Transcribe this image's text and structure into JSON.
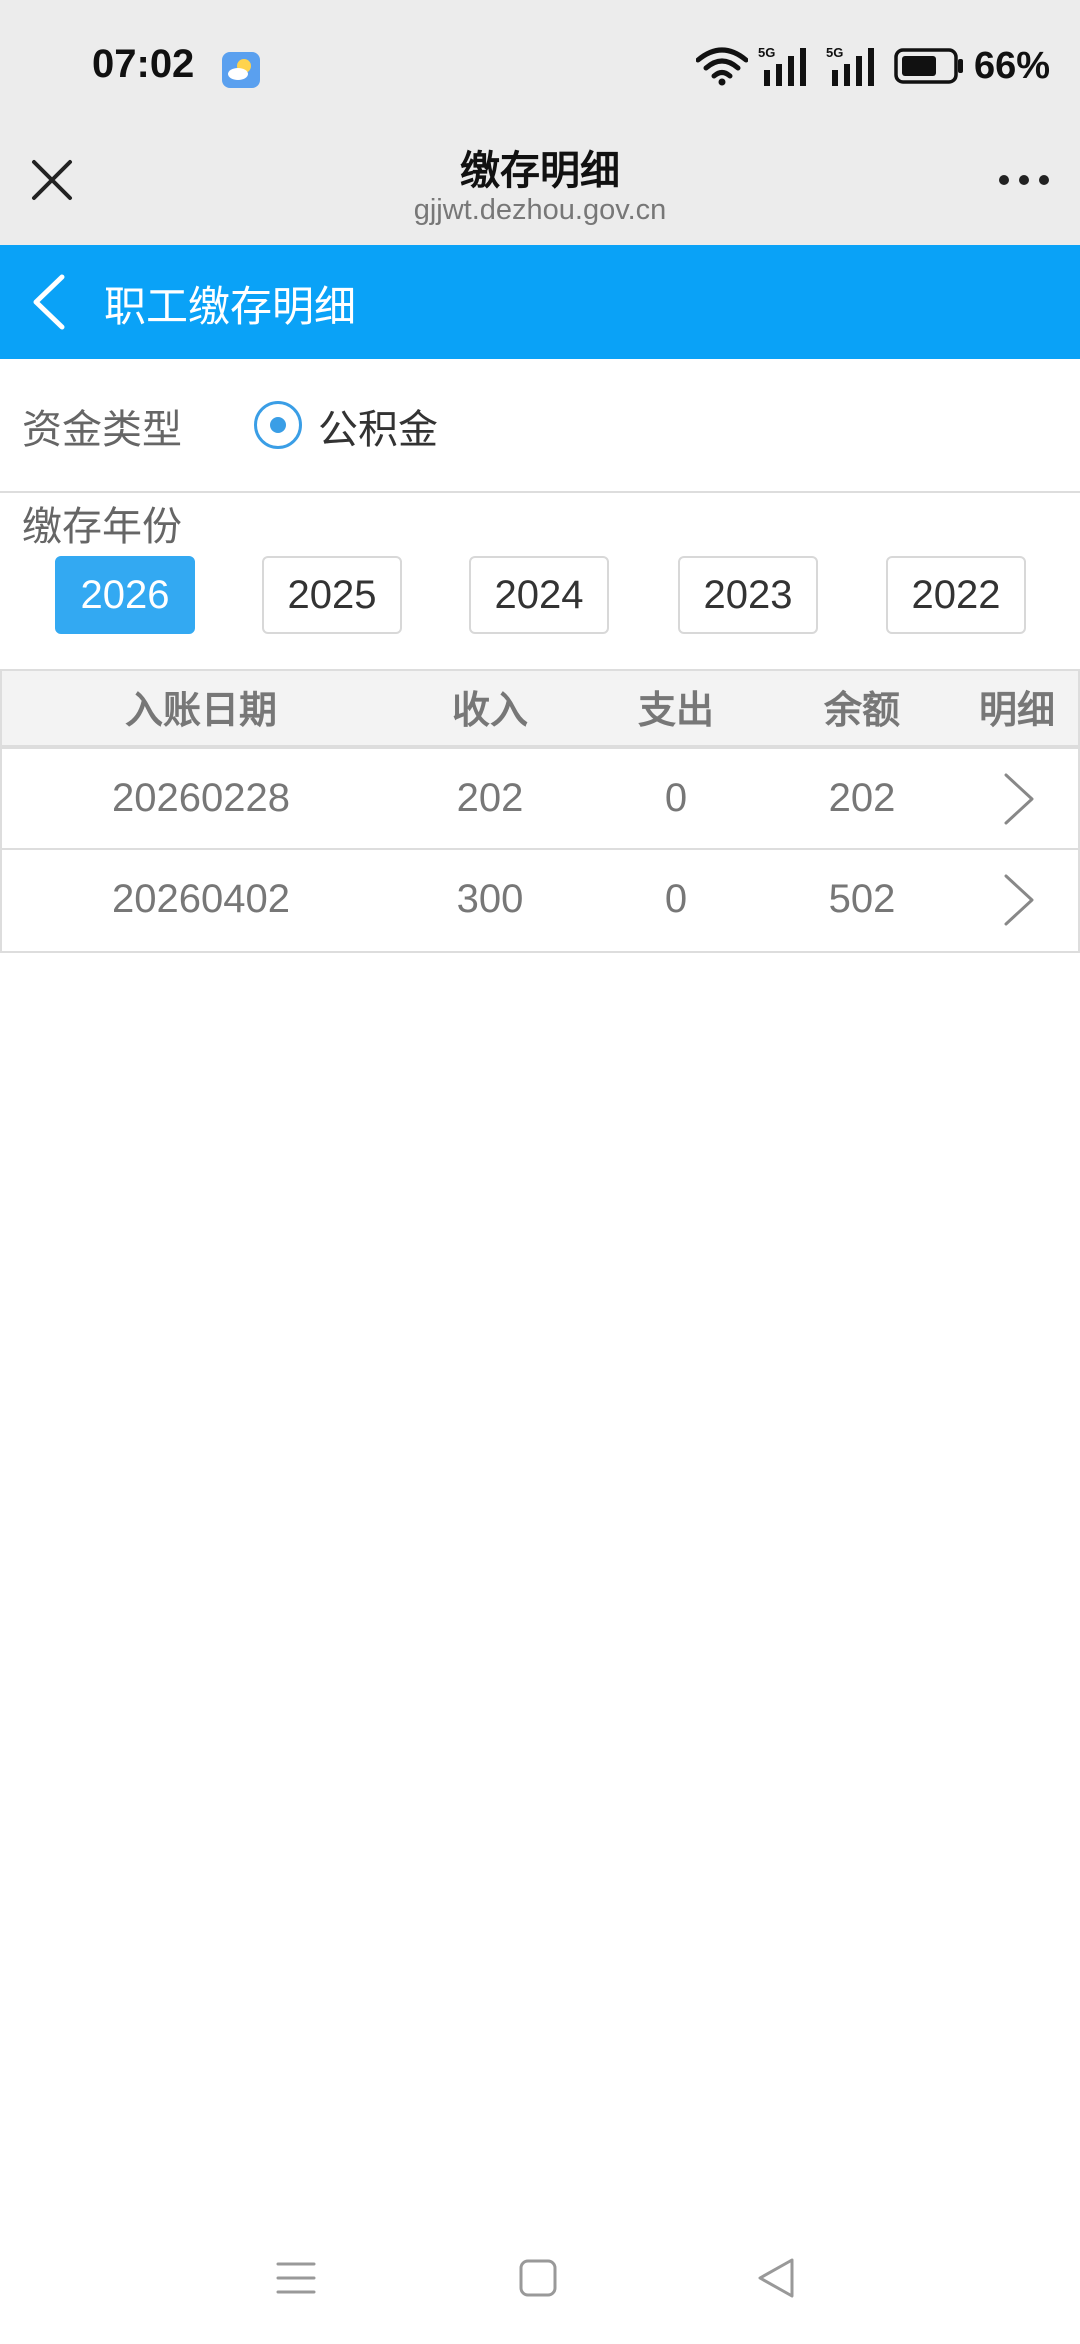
{
  "status_bar": {
    "time": "07:02",
    "battery": "66%",
    "network": [
      "5G",
      "5G"
    ],
    "icons": [
      "wifi-icon",
      "signal-icon",
      "battery-icon"
    ]
  },
  "browser": {
    "title": "缴存明细",
    "url": "gjjwt.dezhou.gov.cn"
  },
  "header": {
    "title": "职工缴存明细"
  },
  "fund_type": {
    "label": "资金类型",
    "option": "公积金",
    "selected": true
  },
  "years": {
    "label": "缴存年份",
    "options": [
      "2026",
      "2025",
      "2024",
      "2023",
      "2022"
    ],
    "selected": "2026"
  },
  "table": {
    "headers": [
      "入账日期",
      "收入",
      "支出",
      "余额",
      "明细"
    ],
    "rows": [
      {
        "date": "20260228",
        "income": "202",
        "expense": "0",
        "balance": "202"
      },
      {
        "date": "20260402",
        "income": "300",
        "expense": "0",
        "balance": "502"
      }
    ]
  },
  "colors": {
    "header_bg": "#0aa2f7",
    "active_year_bg": "#33a9f2",
    "radio": "#3a9ee6"
  }
}
